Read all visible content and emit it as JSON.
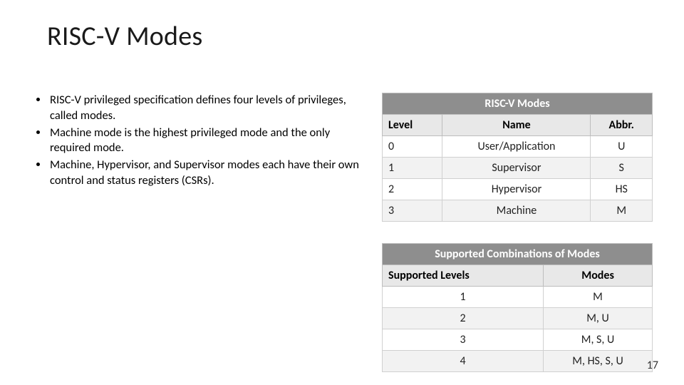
{
  "title": "RISC-V Modes",
  "bullets": [
    "RISC-V privileged specification defines four levels of privileges, called modes.",
    "Machine mode is the highest privileged mode and the only required mode.",
    " Machine, Hypervisor, and Supervisor modes each have their own control and status registers (CSRs)."
  ],
  "table1": {
    "caption": "RISC-V Modes",
    "headers": [
      "Level",
      "Name",
      "Abbr."
    ],
    "rows": [
      [
        "0",
        "User/Application",
        "U"
      ],
      [
        "1",
        "Supervisor",
        "S"
      ],
      [
        "2",
        "Hypervisor",
        "HS"
      ],
      [
        "3",
        "Machine",
        "M"
      ]
    ]
  },
  "table2": {
    "caption": "Supported Combinations of Modes",
    "headers": [
      "Supported Levels",
      "Modes"
    ],
    "rows": [
      [
        "1",
        "M"
      ],
      [
        "2",
        "M, U"
      ],
      [
        "3",
        "M, S, U"
      ],
      [
        "4",
        "M, HS, S, U"
      ]
    ]
  },
  "page_number": "17"
}
